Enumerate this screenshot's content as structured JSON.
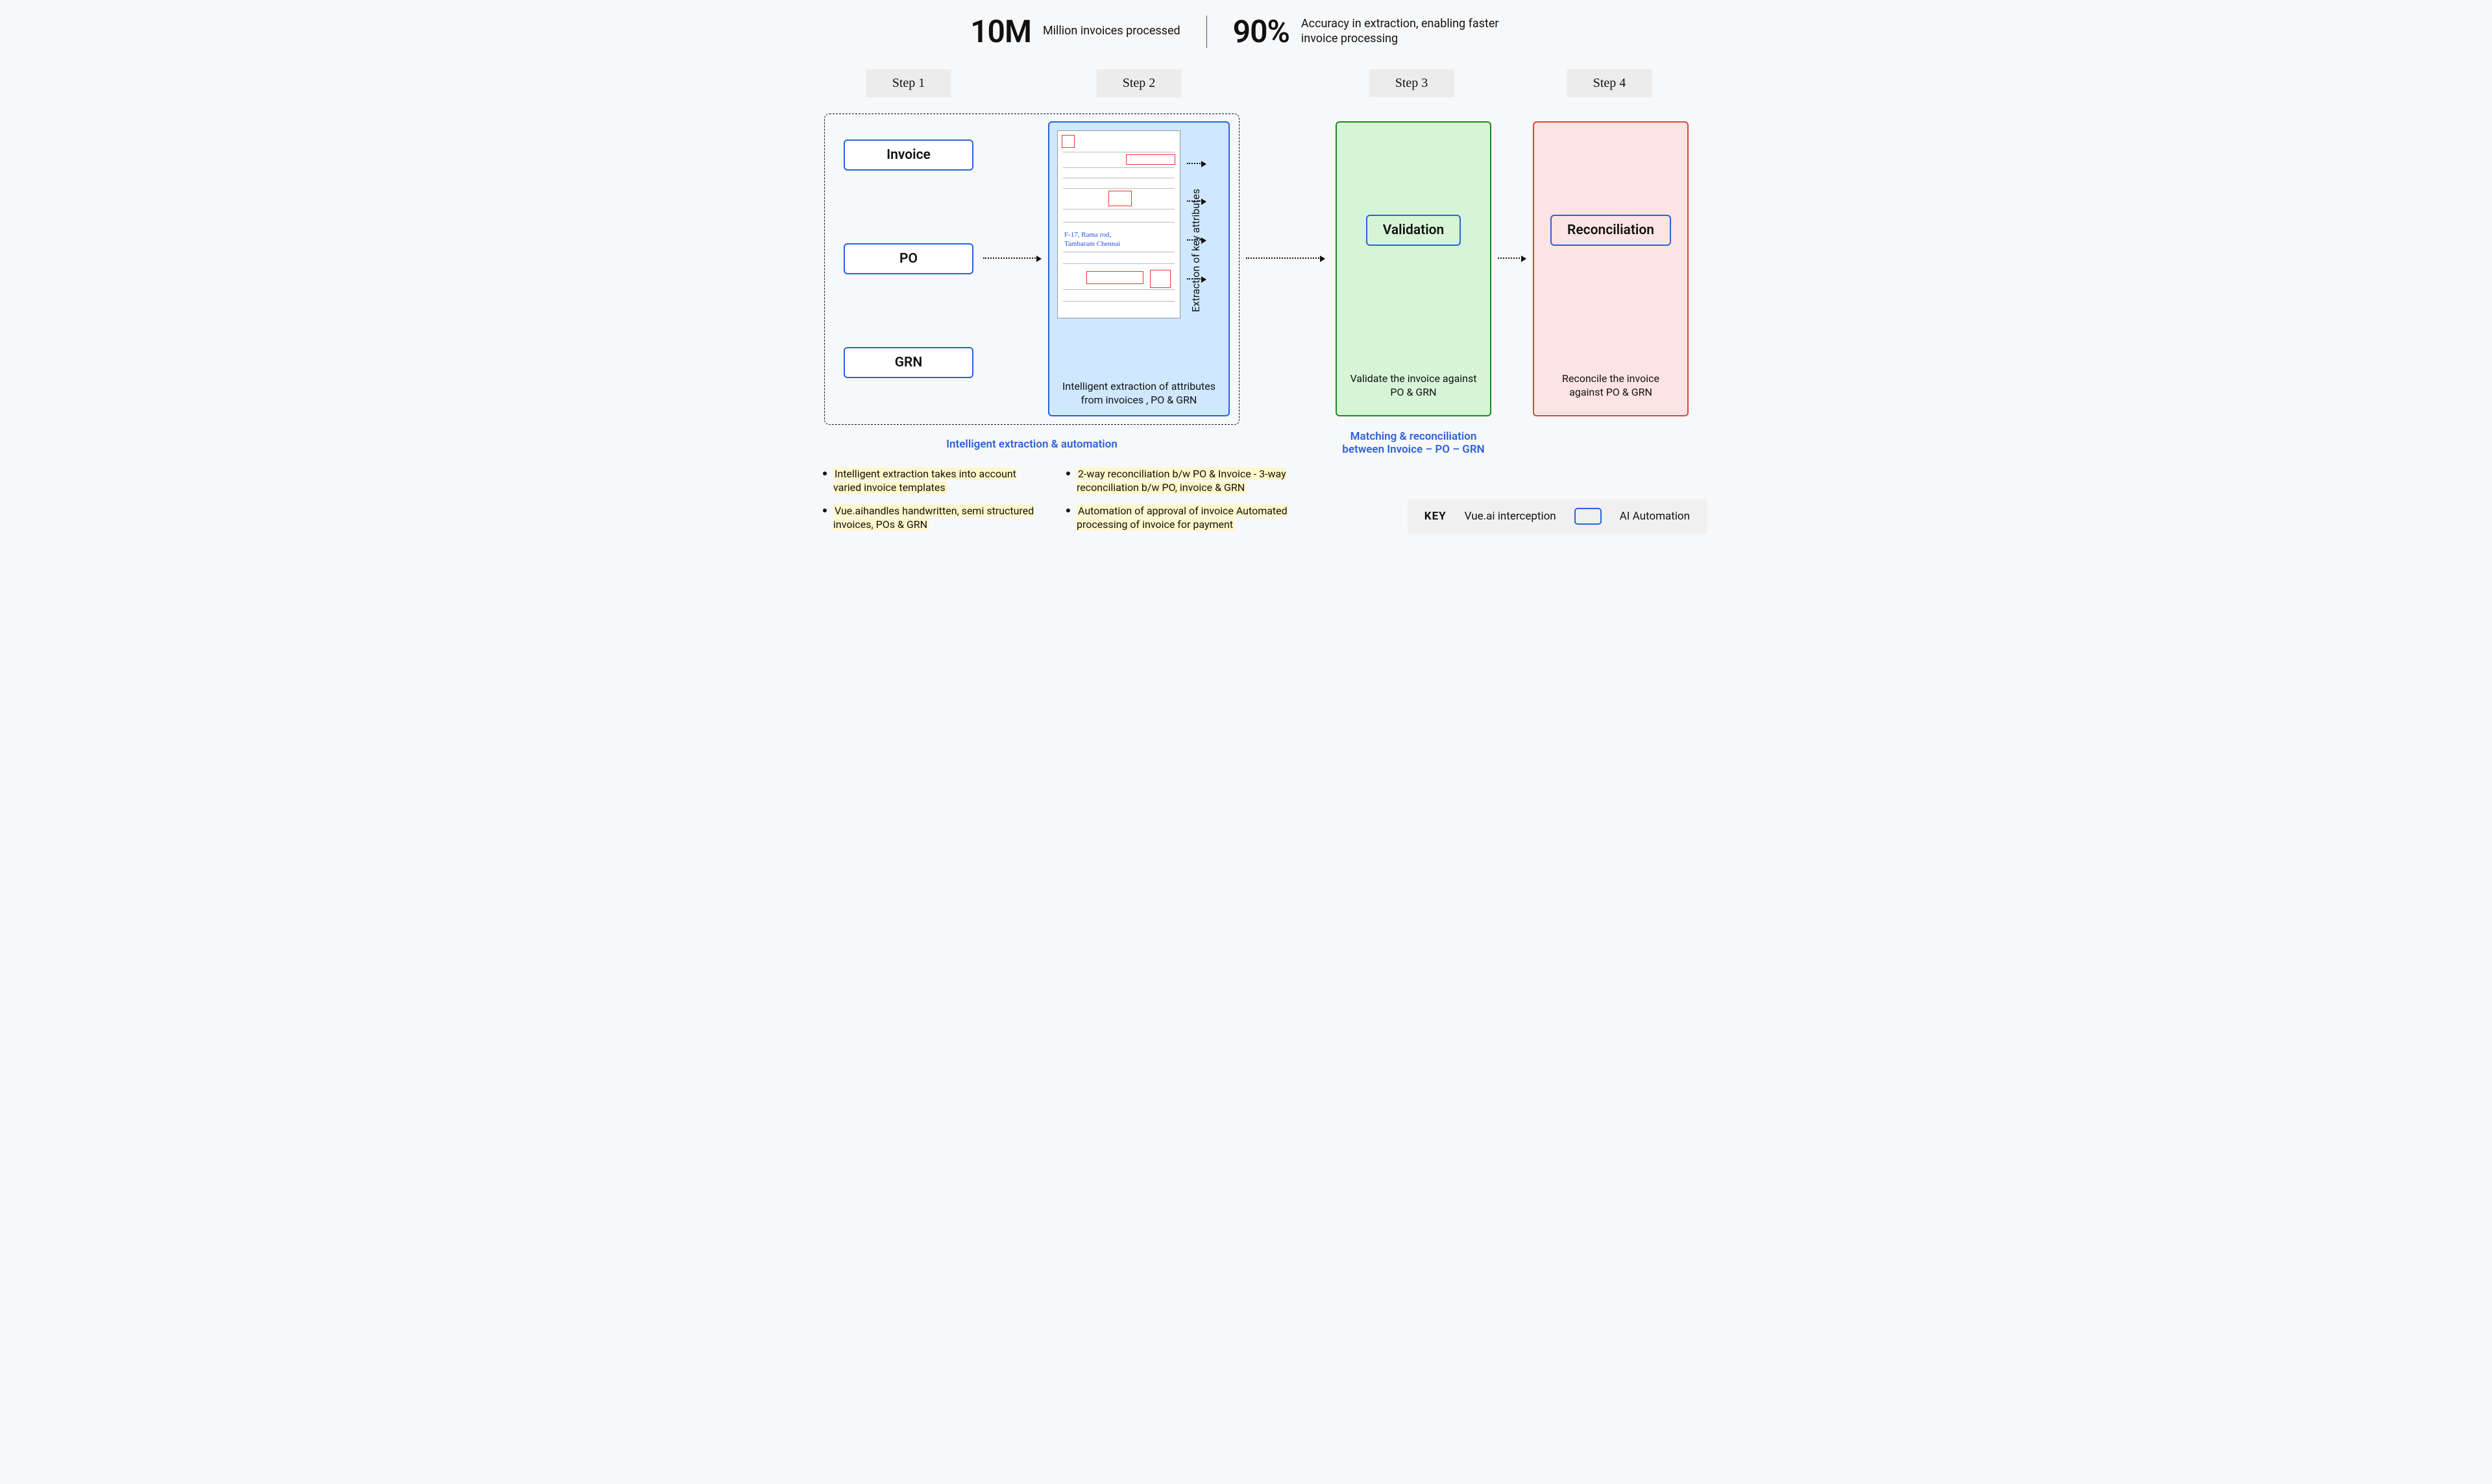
{
  "stats": [
    {
      "num": "10M",
      "desc": "Million invoices processed"
    },
    {
      "num": "90%",
      "desc": "Accuracy in extraction, enabling faster invoice processing"
    }
  ],
  "steps": {
    "labels": [
      "Step 1",
      "Step 2",
      "Step 3",
      "Step 4"
    ]
  },
  "step1": {
    "items": [
      "Invoice",
      "PO",
      "GRN"
    ]
  },
  "step2": {
    "vertical": "Extraction of key attributes",
    "caption": "Intelligent extraction of attributes from invoices , PO & GRN",
    "cursive1": "F-17, Rama rod,",
    "cursive2": "Tambaram Chennai"
  },
  "group1_label": "Intelligent extraction & automation",
  "step3": {
    "title": "Validation",
    "caption": "Validate the invoice against PO & GRN"
  },
  "step4": {
    "title": "Reconciliation",
    "caption": "Reconcile the invoice against PO & GRN"
  },
  "group2_label": "Matching & reconciliation between Invoice – PO – GRN",
  "bullets": [
    "Intelligent extraction takes into account varied invoice templates",
    "2-way reconciliation b/w PO & Invoice - 3-way reconciliation b/w PO, invoice & GRN",
    "Vue.aihandles handwritten, semi structured invoices, POs & GRN",
    "Automation of approval of invoice Automated processing of invoice for payment"
  ],
  "key": {
    "label": "KEY",
    "item1": "Vue.ai interception",
    "item2": "AI Automation"
  }
}
